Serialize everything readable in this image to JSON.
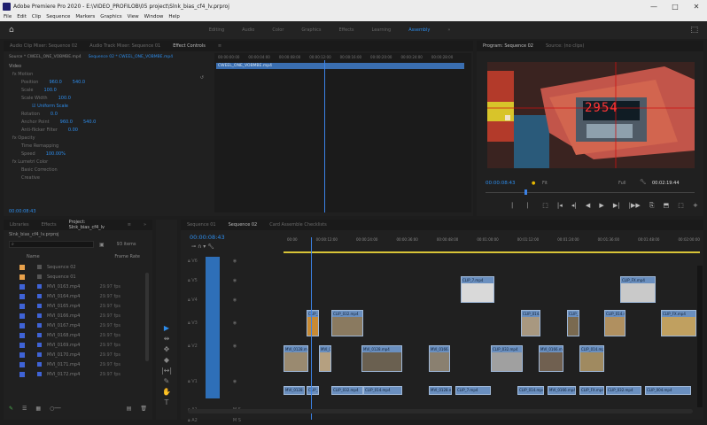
{
  "title_bar": {
    "title": "Adobe Premiere Pro 2020 - E:\\VIDEO_PROFILOB\\05 project\\Slnk_bias_cf4_lv.prproj",
    "minimize": "—",
    "maximize": "□",
    "close": "✕"
  },
  "menu": [
    "File",
    "Edit",
    "Clip",
    "Sequence",
    "Markers",
    "Graphics",
    "View",
    "Window",
    "Help"
  ],
  "workspaces": {
    "home": "⌂",
    "tabs": [
      "Editing",
      "Audio",
      "Color",
      "Graphics",
      "Effects",
      "Learning",
      "Assembly",
      "»"
    ],
    "active": "Assembly",
    "export": "⬚"
  },
  "source_panel": {
    "tabs": [
      "Audio Clip Mixer: Sequence 02",
      "Audio Track Mixer: Sequence 01",
      "Effect Controls",
      "≡"
    ],
    "active_tab": "Effect Controls",
    "source": "Source * CWEEL_ONE_VOBMBE.mp4",
    "sequence": "Sequence 02 * CWEEL_ONE_VOBMBE.mp4",
    "section": "Video",
    "effects": [
      {
        "name": "fx  Motion",
        "value": "",
        "value2": ""
      },
      {
        "name": "Position",
        "value": "960.0",
        "value2": "540.0"
      },
      {
        "name": "Scale",
        "value": "100.0",
        "value2": ""
      },
      {
        "name": "Scale Width",
        "value": "100.0",
        "value2": ""
      },
      {
        "name": "",
        "value": "☑ Uniform Scale",
        "value2": ""
      },
      {
        "name": "Rotation",
        "value": "0.0",
        "value2": ""
      },
      {
        "name": "Anchor Point",
        "value": "960.0",
        "value2": "540.0"
      },
      {
        "name": "Anti-flicker Filter",
        "value": "0.00",
        "value2": ""
      },
      {
        "name": "fx  Opacity",
        "value": "",
        "value2": ""
      },
      {
        "name": "Time Remapping",
        "value": "",
        "value2": ""
      },
      {
        "name": "Speed",
        "value": "100.00%",
        "value2": ""
      },
      {
        "name": "fx  Lumetri Color",
        "value": "",
        "value2": ""
      },
      {
        "name": "Basic Correction",
        "value": "",
        "value2": ""
      },
      {
        "name": "Creative",
        "value": "",
        "value2": ""
      }
    ],
    "timecode": "00:00:08:43",
    "mini_clip": "CWEEL_ONE_VOBMBE.mp4",
    "mini_timecodes": [
      "00:00:00:00",
      "00:00:04:00",
      "00:00:08:00",
      "00:00:12:00",
      "00:00:16:00",
      "00:00:20:00",
      "00:00:24:00",
      "00:00:28:00"
    ]
  },
  "program": {
    "tabs": [
      "Program: Sequence 02",
      "Source: (no clips)"
    ],
    "display_number": "2954",
    "timecode": "00:00:08:43",
    "fit": "Fit",
    "quality": "Full",
    "duration": "00:02:19:44",
    "controls": [
      "⎸",
      "⎸",
      "⬚",
      "|◂",
      "◂|",
      "◀",
      "▶",
      "▶|",
      "|▶▶",
      "⎘",
      "⬒",
      "⬚",
      "+"
    ]
  },
  "project": {
    "tabs": [
      "Libraries",
      "Effects",
      "Project: Slnk_bias_cf4_lv",
      "≡",
      "»"
    ],
    "path": "Slnk_bias_cf4_lv.prproj",
    "items_count": "93 items",
    "col_name": "Name",
    "col_rate": "Frame Rate",
    "rows": [
      {
        "name": "Sequence 02",
        "rate": "",
        "color": "#e8a14b"
      },
      {
        "name": "Sequence 01",
        "rate": "",
        "color": "#e8a14b"
      },
      {
        "name": "MVI_0163.mp4",
        "rate": "29.97 fps",
        "color": "#3f63d6"
      },
      {
        "name": "MVI_0164.mp4",
        "rate": "29.97 fps",
        "color": "#3f63d6"
      },
      {
        "name": "MVI_0165.mp4",
        "rate": "29.97 fps",
        "color": "#3f63d6"
      },
      {
        "name": "MVI_0166.mp4",
        "rate": "29.97 fps",
        "color": "#3f63d6"
      },
      {
        "name": "MVI_0167.mp4",
        "rate": "29.97 fps",
        "color": "#3f63d6"
      },
      {
        "name": "MVI_0168.mp4",
        "rate": "29.97 fps",
        "color": "#3f63d6"
      },
      {
        "name": "MVI_0169.mp4",
        "rate": "29.97 fps",
        "color": "#3f63d6"
      },
      {
        "name": "MVI_0170.mp4",
        "rate": "29.97 fps",
        "color": "#3f63d6"
      },
      {
        "name": "MVI_0171.mp4",
        "rate": "29.97 fps",
        "color": "#3f63d6"
      },
      {
        "name": "MVI_0172.mp4",
        "rate": "29.97 fps",
        "color": "#3f63d6"
      }
    ]
  },
  "tools": [
    "▶",
    "⇹",
    "✥",
    "◆",
    "|↔|",
    "✎",
    "✋",
    "T"
  ],
  "timeline": {
    "tabs": [
      "Sequence 01",
      "Sequence 02",
      "Card Assemble Checklists"
    ],
    "active_tab": "Sequence 02",
    "timecode": "00:00:08:43",
    "ruler": [
      "00:00",
      "00:00:12:00",
      "00:00:24:00",
      "00:00:36:00",
      "00:00:48:00",
      "00:01:00:00",
      "00:01:12:00",
      "00:01:24:00",
      "00:01:36:00",
      "00:01:48:00",
      "00:02:00:00"
    ],
    "tracks": [
      "V6",
      "V5",
      "V4",
      "V3",
      "V2",
      "V1",
      "A1",
      "A2"
    ],
    "clip_labels": [
      "CLIP_004.mp4",
      "CLIP_032.mp4",
      "CLIP_014.mp4",
      "MVI_0128.mp4",
      "MVI_0166.mp4",
      "CLIP_7.mp4",
      "CLIP_FX.mp4"
    ]
  },
  "status": {
    "audio": "Audio Meter"
  },
  "colors": {
    "accent": "#2d8ceb",
    "clip": "#6a8fbf",
    "video_track": "#2e6fb8",
    "playhead": "#3c82e6"
  }
}
